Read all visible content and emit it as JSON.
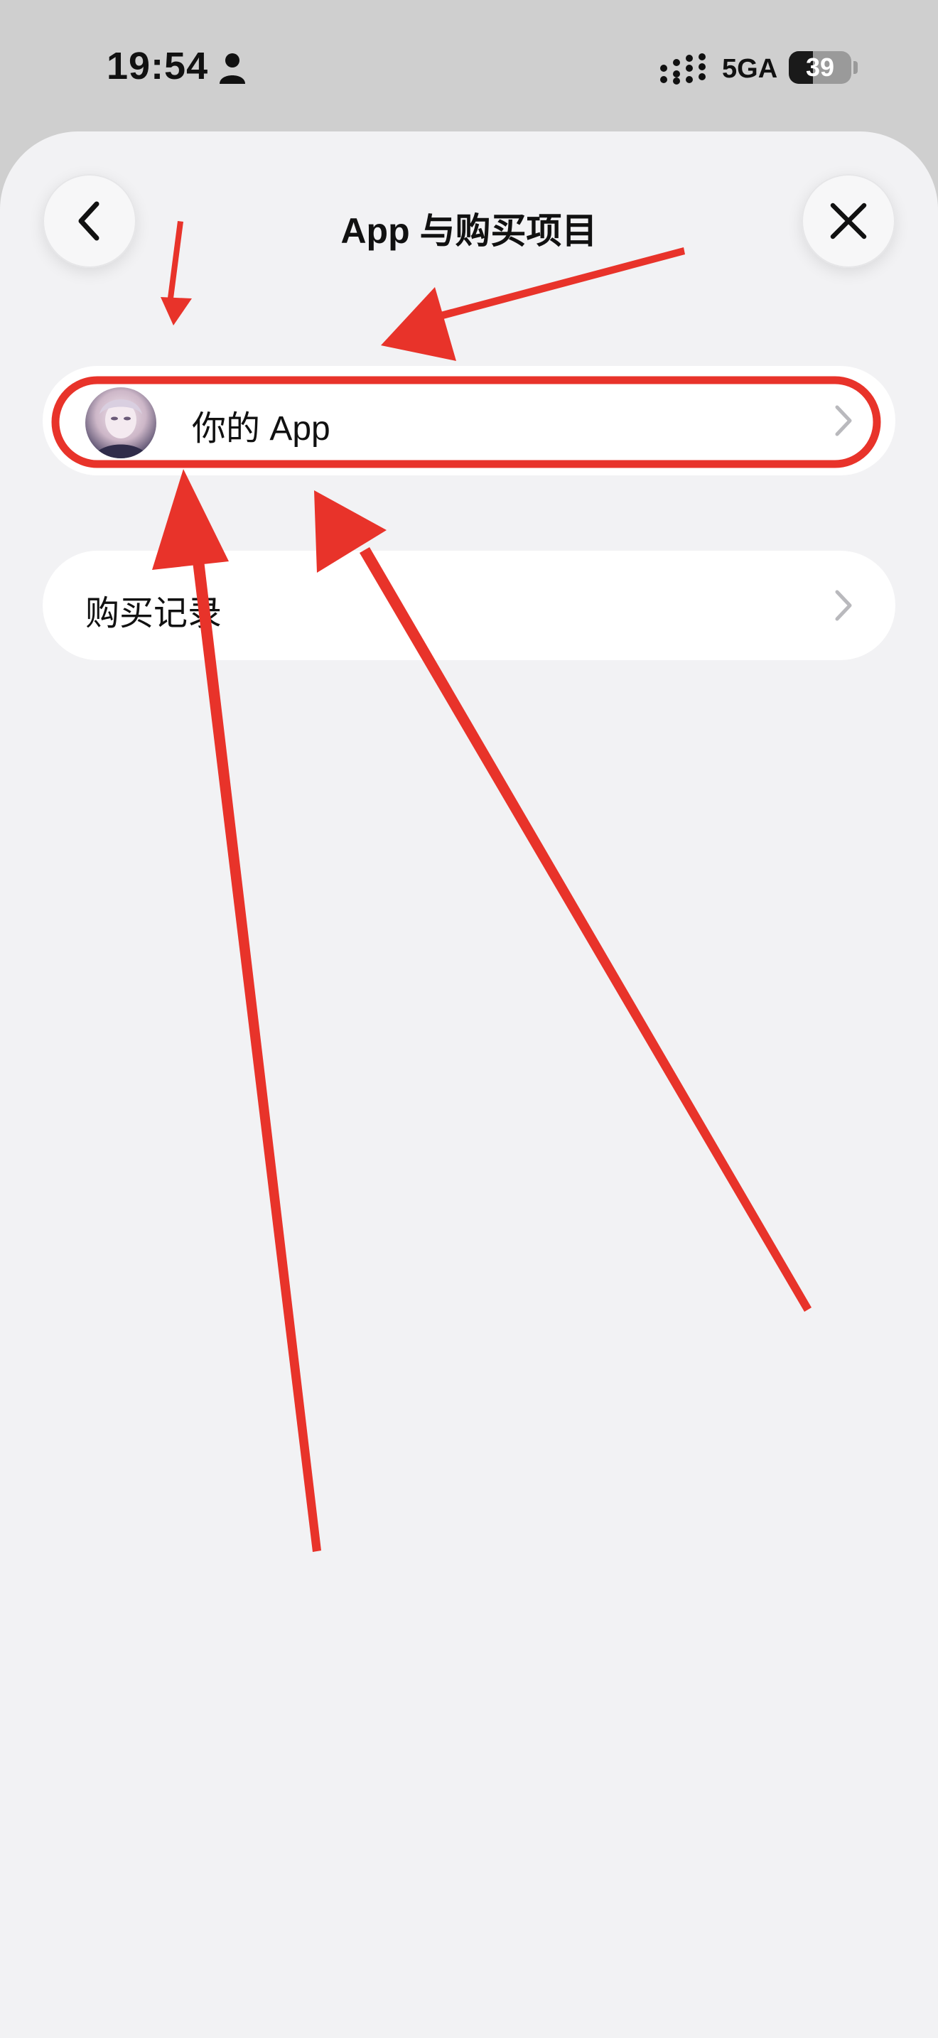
{
  "status_bar": {
    "time": "19:54",
    "network": "5GA",
    "battery_percent": 39,
    "battery_text": "39"
  },
  "nav": {
    "title": "App 与购买项目"
  },
  "rows": {
    "your_apps": {
      "label": "你的 App"
    },
    "purchase_history": {
      "label": "购买记录"
    }
  },
  "colors": {
    "accent_annotation": "#e8332a",
    "sheet_background": "#f2f2f4",
    "row_background": "#ffffff"
  },
  "icons": {
    "back": "chevron-left-icon",
    "close": "close-icon",
    "row_disclosure": "chevron-right-icon",
    "status_person": "person-icon",
    "status_signal": "signal-icon"
  }
}
